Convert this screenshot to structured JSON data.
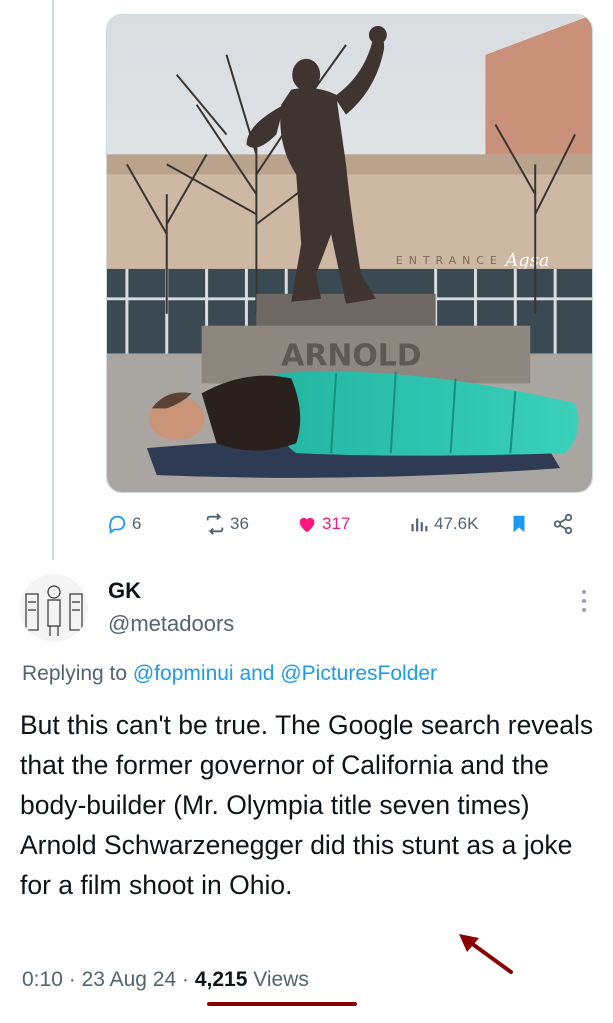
{
  "media": {
    "sign_text": "ARNOLD",
    "building_text": "ENTRANCE",
    "watermark": "Agsa"
  },
  "actions": {
    "replies": "6",
    "reposts": "36",
    "likes": "317",
    "views": "47.6K"
  },
  "reply": {
    "name": "GK",
    "handle": "@metadoors",
    "replying_prefix": "Replying to",
    "mention1": "@fopminui",
    "and": "and",
    "mention2": "@PicturesFolder",
    "text": "But this can't be true. The Google search reveals that the former governor of California and the body-builder (Mr. Olympia title seven times) Arnold Schwarzenegger did this stunt as a joke for a film shoot in Ohio.",
    "time": "0:10",
    "dot": "·",
    "date": "23 Aug 24",
    "views_count": "4,215",
    "views_label": "Views"
  },
  "colors": {
    "accent": "#1d9bf0",
    "like": "#f91880",
    "annotation": "#8b0000"
  }
}
